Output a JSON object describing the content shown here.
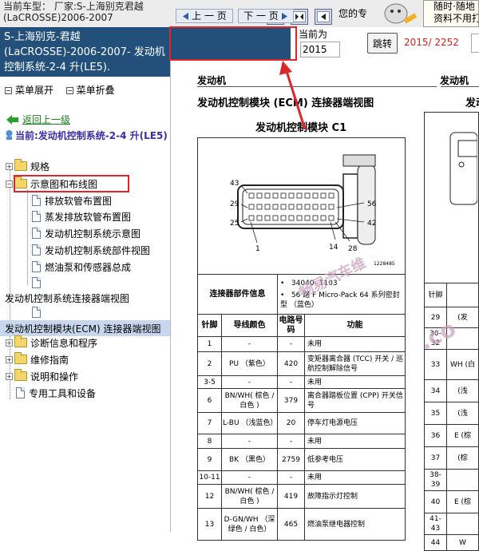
{
  "top": {
    "car_model_line1": "当前车型：  厂家:S-上海别克君越",
    "car_model_line2": "(LaCROSSE)2006-2007",
    "user_text": "您的专",
    "notice_line1": "随时·随地",
    "notice_line2": "资料不用打"
  },
  "left": {
    "title": "S-上海别克-君越(LaCROSSE)-2006-2007- 发动机控制系统-2-4 升(LE5).",
    "expand": "菜单展开",
    "collapse": "菜单折叠",
    "back": "返回上一级",
    "current": "当前:发动机控制系统-2-4 升(LE5)",
    "tree": [
      {
        "label": "规格"
      },
      {
        "label": "示意图和布线图"
      },
      {
        "label": "排放软管布置图"
      },
      {
        "label": "蒸发排放软管布置图"
      },
      {
        "label": "发动机控制系统示意图"
      },
      {
        "label": "发动机控制系统部件视图"
      },
      {
        "label": "燃油泵和传感器总成"
      },
      {
        "label": "发动机控制系统连接器端视图"
      },
      {
        "label": "发动机控制模块(ECM) 连接器端视图"
      },
      {
        "label": "诊断信息和程序"
      },
      {
        "label": "维修指南"
      },
      {
        "label": "说明和操作"
      },
      {
        "label": "专用工具和设备"
      }
    ]
  },
  "nav": {
    "prev": "上 一 页",
    "next": "下 一 页",
    "page_label": "当前为",
    "page_value": "2015",
    "jump": "跳转",
    "page_count": "2015/ 2252"
  },
  "doc": {
    "section": "发动机",
    "section_right": "发动机",
    "ecm_title": "发动机控制模块 (ECM) 连接器端视图",
    "ecm_title_right": "发动",
    "c1_title": "发动机控制模块 C1",
    "diagram_labels": [
      "43",
      "29",
      "25",
      "1",
      "14",
      "28",
      "56",
      "42"
    ],
    "diagram_id": "1228485",
    "watermark": "畅易汽车维",
    "watermark2": ".co",
    "info_label": "连接器部件信息",
    "info_items": [
      "34040- 1103",
      "56 路 F Micro-Pack 64 系列密封型 （蓝色）"
    ],
    "headers": [
      "针脚",
      "导线颜色",
      "电路号码",
      "功能"
    ],
    "rows": [
      [
        "1",
        "-",
        "-",
        "未用"
      ],
      [
        "2",
        "PU （紫色）",
        "420",
        "变矩器离合器 (TCC) 开关 / 巡航控制解除信号"
      ],
      [
        "3-5",
        "-",
        "-",
        "未用"
      ],
      [
        "6",
        "BN/WH( 棕色 / 白色 )",
        "379",
        "离合器踏板位置 (CPP) 开关信号"
      ],
      [
        "7",
        "L-BU （浅蓝色）",
        "20",
        "停车灯电源电压"
      ],
      [
        "8",
        "-",
        "-",
        "未用"
      ],
      [
        "9",
        "BK （黑色）",
        "2759",
        "低参考电压"
      ],
      [
        "10-11",
        "-",
        "-",
        "未用"
      ],
      [
        "12",
        "BN/WH( 棕色 / 白色 )",
        "419",
        "故障指示灯控制"
      ],
      [
        "13",
        "D-GN/WH （深绿色 / 白色）",
        "465",
        "燃油泵继电器控制"
      ]
    ],
    "right_header": "针脚",
    "right_rows": [
      [
        "29",
        "(发"
      ],
      [
        "30-32",
        ""
      ],
      [
        "33",
        "WH (白"
      ],
      [
        "34",
        "(浅"
      ],
      [
        "35",
        "(浅"
      ],
      [
        "36",
        "E (棕"
      ],
      [
        "37",
        "(棕"
      ],
      [
        "38-39",
        ""
      ],
      [
        "40",
        "E (棕"
      ],
      [
        "41-43",
        ""
      ],
      [
        "44",
        "W"
      ]
    ]
  }
}
